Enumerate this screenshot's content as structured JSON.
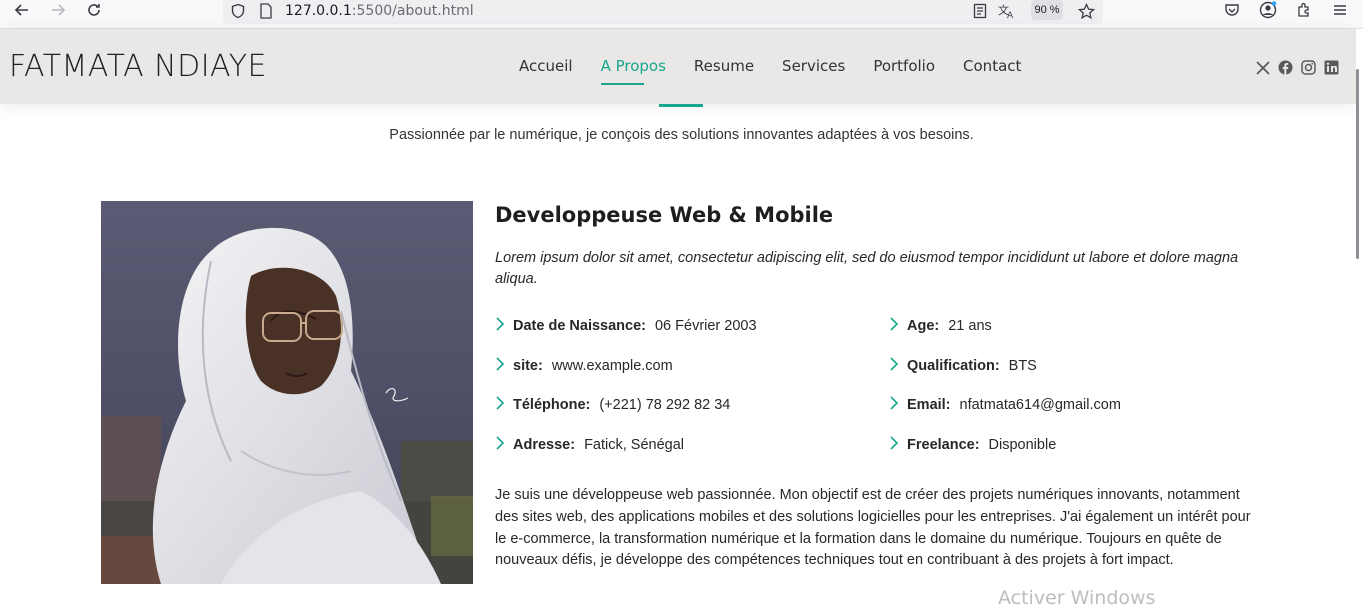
{
  "browser": {
    "url_host": "127.0.0.1",
    "url_path": ":5500/about.html",
    "zoom": "90 %",
    "icons": [
      "back-icon",
      "forward-icon",
      "reload-icon",
      "shield-icon",
      "page-icon",
      "reader-icon",
      "translate-icon",
      "bookmark-star-icon",
      "pocket-icon",
      "account-icon",
      "extensions-icon",
      "menu-icon"
    ]
  },
  "header": {
    "logo": "FATMATA NDIAYE",
    "nav": [
      {
        "label": "Accueil"
      },
      {
        "label": "A Propos"
      },
      {
        "label": "Resume"
      },
      {
        "label": "Services"
      },
      {
        "label": "Portfolio"
      },
      {
        "label": "Contact"
      }
    ],
    "socials": [
      "x-twitter-icon",
      "facebook-icon",
      "instagram-icon",
      "linkedin-icon"
    ]
  },
  "section": {
    "tagline": "Passionnée par le numérique, je conçois des solutions innovantes adaptées à vos besoins."
  },
  "about": {
    "title": "Developpeuse Web & Mobile",
    "intro": "Lorem ipsum dolor sit amet, consectetur adipiscing elit, sed do eiusmod tempor incididunt ut labore et dolore magna aliqua.",
    "info": [
      {
        "label": "Date de Naissance:",
        "value": "06 Février 2003"
      },
      {
        "label": "Age:",
        "value": "21 ans"
      },
      {
        "label": "site:",
        "value": "www.example.com"
      },
      {
        "label": "Qualification:",
        "value": "BTS"
      },
      {
        "label": "Téléphone:",
        "value": "(+221) 78 292 82 34"
      },
      {
        "label": "Email:",
        "value": "nfatmata614@gmail.com"
      },
      {
        "label": "Adresse:",
        "value": "Fatick, Sénégal"
      },
      {
        "label": "Freelance:",
        "value": "Disponible"
      }
    ],
    "bio": "Je suis une développeuse web passionnée. Mon objectif est de créer des projets numériques innovants, notamment des sites web, des applications mobiles et des solutions logicielles pour les entreprises. J'ai également un intérêt pour le e-commerce, la transformation numérique et la formation dans le domaine du numérique. Toujours en quête de nouveaux défis, je développe des compétences techniques tout en contribuant à des projets à fort impact."
  },
  "os_watermark": "Activer Windows"
}
